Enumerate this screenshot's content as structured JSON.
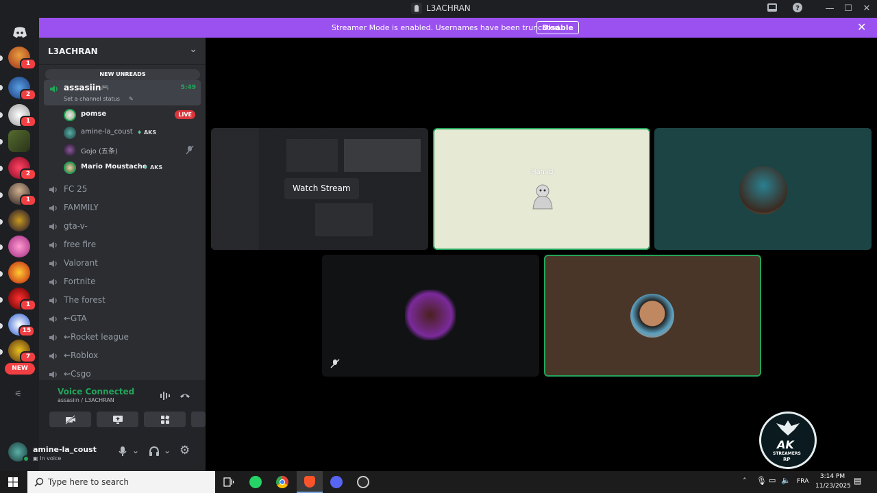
{
  "window": {
    "title": "L3ACHRAN"
  },
  "banner": {
    "message": "Streamer Mode is enabled. Usernames have been truncated.",
    "disable_label": "Disable"
  },
  "server_rail": {
    "badges": [
      "1",
      "2",
      "1",
      "2",
      "1",
      "1",
      "15",
      "7"
    ],
    "new_label": "NEW"
  },
  "guild": {
    "name": "L3ACHRAN"
  },
  "sidebar": {
    "unreads_label": "NEW UNREADS",
    "active_channel": {
      "name": "assasiin",
      "status": "Set a channel status",
      "timer": "5:49"
    },
    "voice_users": [
      {
        "name": "pomse",
        "live": "LIVE"
      },
      {
        "name": "amine-la_coust",
        "tag": "AKS"
      },
      {
        "name": "Gojo (五条)"
      },
      {
        "name": "Mario Moustache",
        "tag": "AKS"
      }
    ],
    "channels": [
      "FC 25",
      "FAMMILY",
      "gta-v-",
      "free fire",
      "Valorant",
      "Fortnite",
      "The forest",
      "⇜GTA",
      "⇜Rocket league",
      "⇜Roblox",
      "⇜Csgo"
    ]
  },
  "voice_panel": {
    "title": "Voice Connected",
    "subtitle": "assasiin / L3ACHRAN"
  },
  "user_panel": {
    "username": "amine-la_coust",
    "status": "In voice"
  },
  "stage": {
    "watch_label": "Watch Stream",
    "hamid_label": "Hamid"
  },
  "taskbar": {
    "search_placeholder": "Type here to search",
    "lang": "FRA",
    "time": "3:14 PM",
    "date": "11/23/2025"
  },
  "logo": {
    "line1": "AK",
    "line2": "STREAMERS",
    "line3": "RP"
  },
  "colors": {
    "accent": "#9b51f0",
    "voice_green": "#23a55a",
    "live_red": "#da373c",
    "badge_red": "#f23f43"
  }
}
